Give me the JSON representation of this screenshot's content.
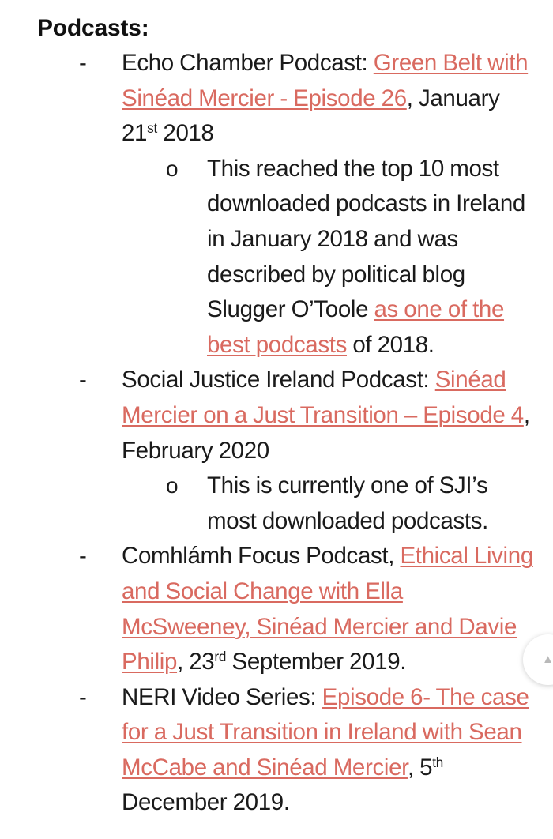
{
  "document": {
    "heading": "Podcasts:",
    "bullet_marker": "-",
    "sub_marker": "o",
    "link_color": "#D96A60",
    "text_color": "#1A1A1A",
    "background_color": "#FFFFFF",
    "items": [
      {
        "prefix": "Echo Chamber Podcast: ",
        "link": "Green Belt with Sinéad Mercier - Episode 26",
        "suffix_before_sup": ", January 21",
        "superscript": "st",
        "suffix_after_sup": " 2018",
        "sub_items": [
          {
            "part1": "This reached the top 10 most downloaded podcasts in Ireland in January 2018 and was described by political blog Slugger O’Toole ",
            "link": "as one of the best podcasts",
            "part2": " of 2018."
          }
        ]
      },
      {
        "prefix": "Social Justice Ireland Podcast: ",
        "link": "Sinéad Mercier on a Just Transition – Episode 4",
        "suffix_before_sup": ", February 2020",
        "superscript": "",
        "suffix_after_sup": "",
        "sub_items": [
          {
            "part1": "This is currently one of SJI’s most downloaded podcasts.",
            "link": "",
            "part2": ""
          }
        ]
      },
      {
        "prefix": "Comhlámh Focus Podcast, ",
        "link": "Ethical Living and Social Change with Ella McSweeney, Sinéad Mercier and Davie Philip",
        "suffix_before_sup": ", 23",
        "superscript": "rd",
        "suffix_after_sup": " September 2019.",
        "sub_items": []
      },
      {
        "prefix": "NERI Video Series: ",
        "link": "Episode 6- The case for a Just Transition in Ireland with Sean McCabe and Sinéad Mercier",
        "suffix_before_sup": ", 5",
        "superscript": "th",
        "suffix_after_sup": " December 2019.",
        "sub_items": []
      }
    ]
  },
  "overlay": {
    "floating_button": {
      "icon": "chevron-collapse-icon",
      "glyph": "▲▼"
    }
  }
}
